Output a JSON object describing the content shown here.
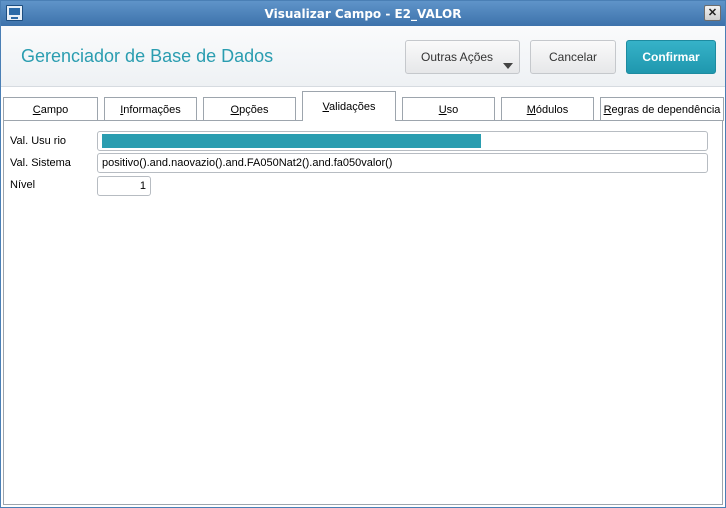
{
  "window": {
    "title": "Visualizar Campo - E2_VALOR",
    "close_glyph": "✕"
  },
  "header": {
    "app_title": "Gerenciador de Base de Dados",
    "buttons": {
      "outras_acoes": "Outras Ações",
      "cancelar": "Cancelar",
      "confirmar": "Confirmar"
    }
  },
  "tabs": [
    {
      "label": "Campo",
      "active": false
    },
    {
      "label": "Informações",
      "active": false
    },
    {
      "label": "Opções",
      "active": false
    },
    {
      "label": "Validações",
      "active": true
    },
    {
      "label": "Uso",
      "active": false
    },
    {
      "label": "Módulos",
      "active": false
    },
    {
      "label": "Regras de dependência",
      "active": false
    }
  ],
  "form": {
    "val_usuario": {
      "label": "Val. Usu rio",
      "value": "",
      "selection_fraction": 0.63
    },
    "val_sistema": {
      "label": "Val. Sistema",
      "value": "positivo().and.naovazio().and.FA050Nat2().and.fa050valor()"
    },
    "nivel": {
      "label": "Nível",
      "value": "1"
    }
  },
  "colors": {
    "accent": "#2a9db0",
    "titlebar": "#3d72ab",
    "confirm_button": "#1f97ae"
  },
  "icons": {
    "app": "window-app-icon",
    "close": "close-icon",
    "dropdown": "chevron-down-icon"
  }
}
